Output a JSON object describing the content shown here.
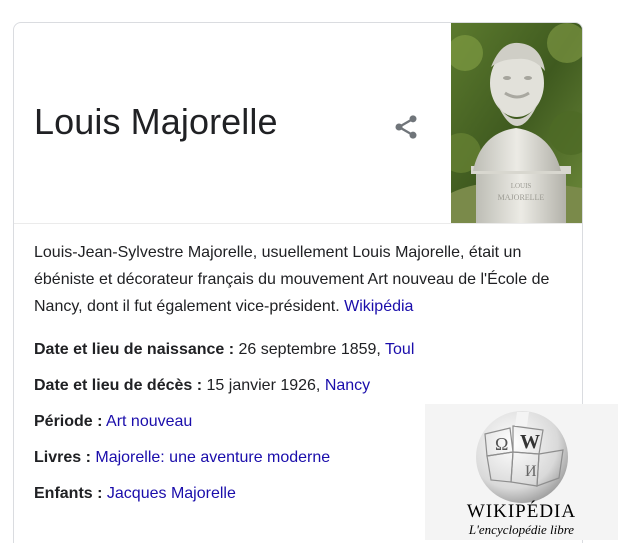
{
  "panel": {
    "title": "Louis Majorelle",
    "portrait_icon": "bust-photo",
    "share_icon": "share-icon"
  },
  "description": {
    "text": "Louis-Jean-Sylvestre Majorelle, usuellement Louis Majorelle, était un ébéniste et décorateur français du mouvement Art nouveau de l'École de Nancy, dont il fut également vice-président.",
    "source_link": "Wikipédia"
  },
  "facts": [
    {
      "label": "Date et lieu de naissance :",
      "text": "26 septembre 1859, ",
      "link": "Toul"
    },
    {
      "label": "Date et lieu de décès :",
      "text": "15 janvier 1926, ",
      "link": "Nancy"
    },
    {
      "label": "Période :",
      "text": "",
      "link": "Art nouveau"
    },
    {
      "label": "Livres :",
      "text": "",
      "link": "Majorelle: une aventure moderne"
    },
    {
      "label": "Enfants :",
      "text": "",
      "link": "Jacques Majorelle"
    }
  ],
  "wikipedia_logo": {
    "wordmark": "WIKIPÉDIA",
    "tagline": "L'encyclopédie libre",
    "glyphs": [
      "Ω",
      "W",
      "И"
    ]
  },
  "colors": {
    "link": "#1a0dab",
    "text": "#202124",
    "border": "#dadce0"
  }
}
